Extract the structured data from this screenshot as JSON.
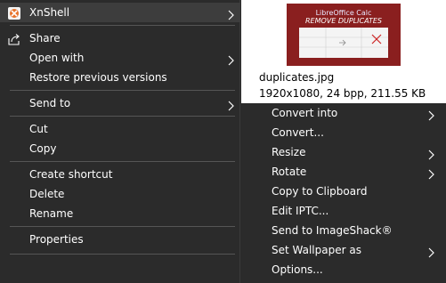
{
  "context_menu": {
    "items": [
      {
        "label": "XnShell",
        "icon": "xnshell-icon",
        "submenu": true
      },
      {
        "label": "Share",
        "icon": "share-icon",
        "submenu": false
      },
      {
        "label": "Open with",
        "submenu": true
      },
      {
        "label": "Restore previous versions",
        "submenu": false
      },
      {
        "label": "Send to",
        "submenu": true
      },
      {
        "label": "Cut",
        "submenu": false
      },
      {
        "label": "Copy",
        "submenu": false
      },
      {
        "label": "Create shortcut",
        "submenu": false
      },
      {
        "label": "Delete",
        "submenu": false
      },
      {
        "label": "Rename",
        "submenu": false
      },
      {
        "label": "Properties",
        "submenu": false
      }
    ]
  },
  "preview": {
    "thumbnail_title": "LibreOffice Calc",
    "thumbnail_subtitle": "REMOVE DUPLICATES",
    "file_name": "duplicates.jpg",
    "file_info": "1920x1080, 24 bpp, 211.55 KB"
  },
  "submenu": {
    "items": [
      {
        "label": "Convert into",
        "submenu": true
      },
      {
        "label": "Convert...",
        "submenu": false
      },
      {
        "label": "Resize",
        "submenu": true
      },
      {
        "label": "Rotate",
        "submenu": true
      },
      {
        "label": "Copy to Clipboard",
        "submenu": false
      },
      {
        "label": "Edit IPTC...",
        "submenu": false
      },
      {
        "label": "Send to ImageShack®",
        "submenu": false
      },
      {
        "label": "Set Wallpaper as",
        "submenu": true
      },
      {
        "label": "Options...",
        "submenu": false
      }
    ]
  },
  "colors": {
    "menu_bg": "#2b2b2b",
    "highlight_bg": "#3d3d3d",
    "text": "#ffffff",
    "separator": "#555555"
  }
}
